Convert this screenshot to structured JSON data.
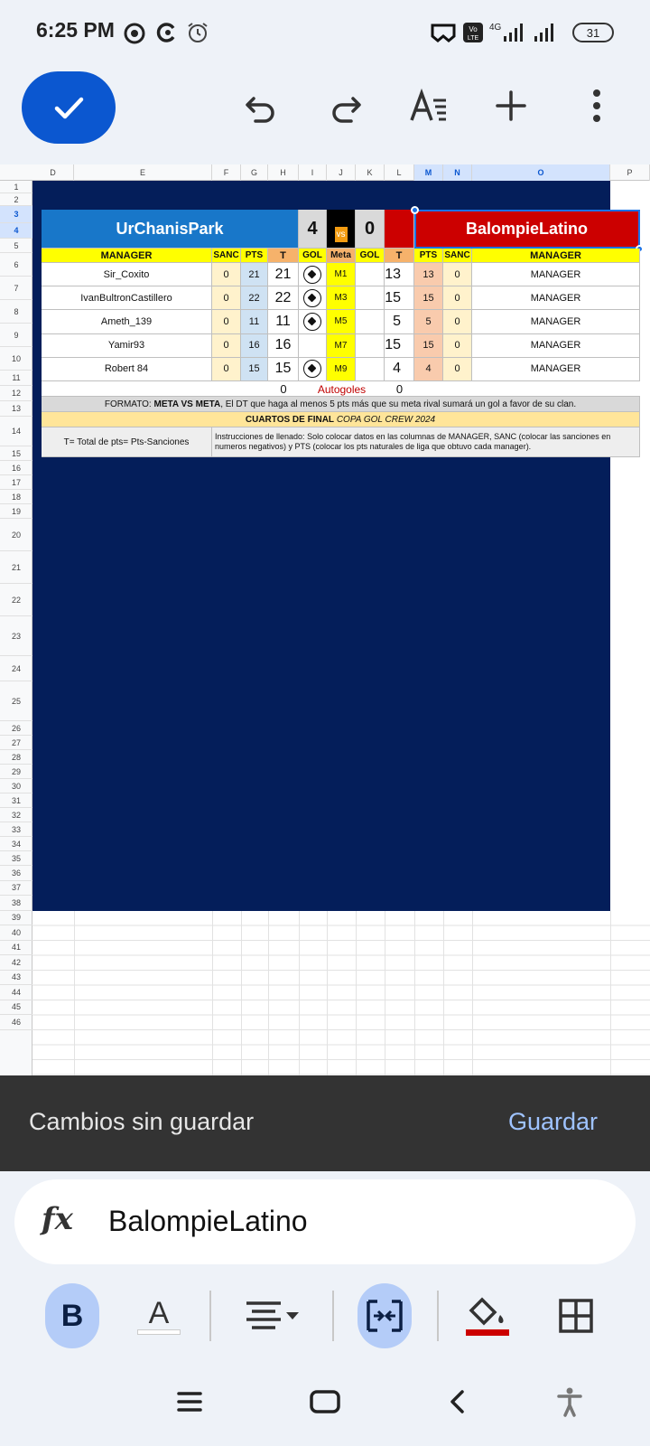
{
  "status": {
    "time": "6:25 PM",
    "battery": "31",
    "network": "4G"
  },
  "sheet": {
    "columns": [
      "D",
      "E",
      "F",
      "G",
      "H",
      "I",
      "J",
      "K",
      "L",
      "M",
      "N",
      "O",
      "P"
    ],
    "rows": [
      "1",
      "2",
      "3",
      "4",
      "5",
      "6",
      "7",
      "8",
      "9",
      "10",
      "11",
      "12",
      "13",
      "14",
      "15",
      "16",
      "17",
      "18",
      "19",
      "20",
      "21",
      "22",
      "23",
      "24",
      "25",
      "26",
      "27",
      "28",
      "29",
      "30",
      "31",
      "32",
      "33",
      "34",
      "35",
      "36",
      "37",
      "38",
      "39",
      "40",
      "41",
      "42",
      "43",
      "44",
      "45",
      "46"
    ],
    "team_left": "UrChanisPark",
    "team_right": "BalompieLatino",
    "score_left": "4",
    "score_right": "0",
    "vs": "vs",
    "headers": [
      "MANAGER",
      "SANC",
      "PTS",
      "T",
      "GOL",
      "Meta",
      "GOL",
      "T",
      "PTS",
      "SANC",
      "MANAGER"
    ],
    "matches": [
      {
        "left_manager": "Sir_Coxito",
        "left_sanc": "0",
        "left_pts": "21",
        "left_t": "21",
        "left_gol": true,
        "meta": "M1",
        "right_gol": false,
        "right_t": "13",
        "right_pts": "13",
        "right_sanc": "0",
        "right_manager": "MANAGER"
      },
      {
        "left_manager": "IvanBultronCastillero",
        "left_sanc": "0",
        "left_pts": "22",
        "left_t": "22",
        "left_gol": true,
        "meta": "M3",
        "right_gol": false,
        "right_t": "15",
        "right_pts": "15",
        "right_sanc": "0",
        "right_manager": "MANAGER"
      },
      {
        "left_manager": "Ameth_139",
        "left_sanc": "0",
        "left_pts": "11",
        "left_t": "11",
        "left_gol": true,
        "meta": "M5",
        "right_gol": false,
        "right_t": "5",
        "right_pts": "5",
        "right_sanc": "0",
        "right_manager": "MANAGER"
      },
      {
        "left_manager": "Yamir93",
        "left_sanc": "0",
        "left_pts": "16",
        "left_t": "16",
        "left_gol": false,
        "meta": "M7",
        "right_gol": false,
        "right_t": "15",
        "right_pts": "15",
        "right_sanc": "0",
        "right_manager": "MANAGER"
      },
      {
        "left_manager": "Robert 84",
        "left_sanc": "0",
        "left_pts": "15",
        "left_t": "15",
        "left_gol": true,
        "meta": "M9",
        "right_gol": false,
        "right_t": "4",
        "right_pts": "4",
        "right_sanc": "0",
        "right_manager": "MANAGER"
      }
    ],
    "autogoles_left": "0",
    "autogoles_label": "Autogoles",
    "autogoles_right": "0",
    "formato_label": "FORMATO:",
    "formato_bold": "META VS META",
    "formato_text": ", El DT que haga al menos 5 pts más que su meta rival sumará un gol a favor de su clan.",
    "cuartos_bold": "CUARTOS DE FINAL",
    "cuartos_italic": "COPA GOL CREW 2024",
    "total_note": "T= Total de pts=  Pts-Sanciones",
    "instructions": "Instrucciones de llenado: Solo colocar datos en las columnas de MANAGER, SANC (colocar las sanciones en numeros negativos) y PTS (colocar los pts naturales de liga que obtuvo cada manager)."
  },
  "unsaved": {
    "message": "Cambios sin guardar",
    "save_label": "Guardar"
  },
  "formula": {
    "fx": "fx",
    "value": "BalompieLatino"
  },
  "format": {
    "bold_label": "B",
    "text_color_label": "A",
    "fill_color": "#cc0000"
  }
}
